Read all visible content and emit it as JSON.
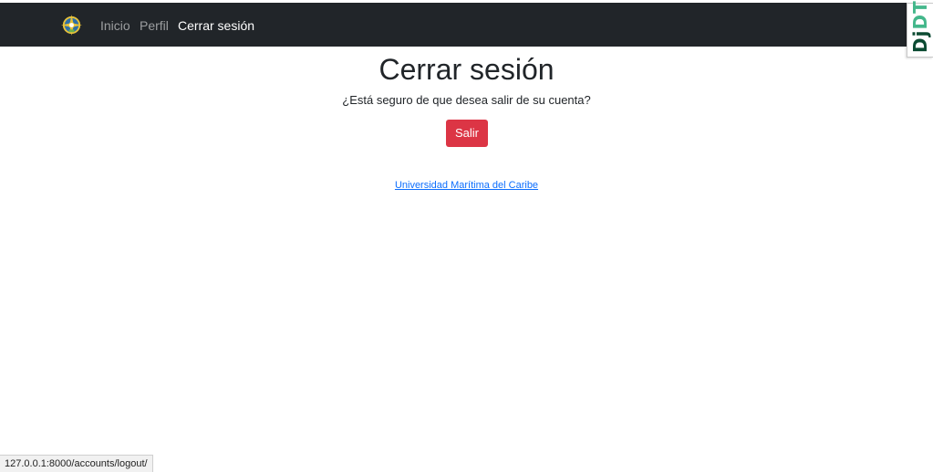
{
  "navbar": {
    "logo_icon": "compass-rose-logo-icon",
    "links": [
      {
        "label": "Inicio",
        "active": false
      },
      {
        "label": "Perfil",
        "active": false
      },
      {
        "label": "Cerrar sesión",
        "active": true
      }
    ]
  },
  "debug_toolbar": {
    "prefix": "Dj",
    "suffix": "DT"
  },
  "main": {
    "title": "Cerrar sesión",
    "message": "¿Está seguro de que desea salir de su cuenta?",
    "button_label": "Salir",
    "footer_link": "Universidad Marítima del Caribe"
  },
  "status_bar": {
    "url": "127.0.0.1:8000/accounts/logout/"
  },
  "colors": {
    "navbar_bg": "#212529",
    "danger": "#dc3545",
    "link": "#0d6efd"
  }
}
